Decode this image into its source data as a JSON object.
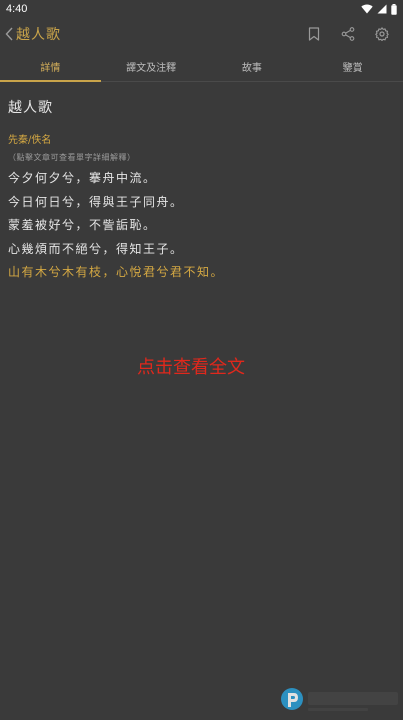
{
  "status_bar": {
    "time": "4:40"
  },
  "app_bar": {
    "title": "越人歌"
  },
  "tabs": [
    {
      "label": "詳情",
      "active": true
    },
    {
      "label": "譯文及注釋",
      "active": false
    },
    {
      "label": "故事",
      "active": false
    },
    {
      "label": "鑒賞",
      "active": false
    }
  ],
  "poem": {
    "title": "越人歌",
    "author": "先秦/佚名",
    "hint": "（點擊文章可查看單字詳細解釋）",
    "lines": [
      {
        "text": "今夕何夕兮，搴舟中流。",
        "highlight": false
      },
      {
        "text": "今日何日兮，得與王子同舟。",
        "highlight": false
      },
      {
        "text": "蒙羞被好兮，不訾詬恥。",
        "highlight": false
      },
      {
        "text": "心幾煩而不絕兮，得知王子。",
        "highlight": false
      },
      {
        "text": "山有木兮木有枝，心悅君兮君不知。",
        "highlight": true
      }
    ]
  },
  "read_more": "点击查看全文",
  "colors": {
    "background": "#3a3a3a",
    "accent": "#c9a44a",
    "read_more": "#e0281c"
  }
}
